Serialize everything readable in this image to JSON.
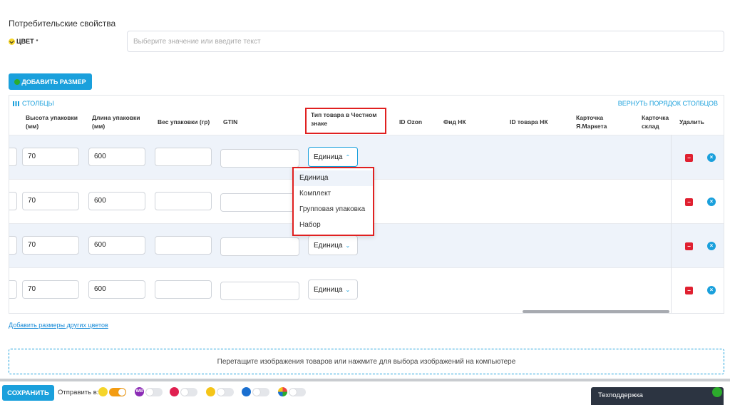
{
  "section": {
    "title": "Потребительские свойства"
  },
  "color_field": {
    "label": "ЦВЕТ",
    "required_mark": "*",
    "placeholder": "Выберите значение или введите текст"
  },
  "add_size_button": "ДОБАВИТЬ РАЗМЕР",
  "table": {
    "columns_toggle": "СТОЛБЦЫ",
    "reset_order": "ВЕРНУТЬ ПОРЯДОК СТОЛБЦОВ",
    "headers": {
      "height": "Высота упаковки (мм)",
      "length": "Длина упаковки (мм)",
      "weight": "Вес упаковки (гр)",
      "gtin": "GTIN",
      "type": "Тип товара в Честном знаке",
      "id_ozon": "ID Ozon",
      "feed_nk": "Фид НК",
      "id_nk": "ID товара НК",
      "card_ym": "Карточка Я.Маркета",
      "card_stock": "Карточка склад",
      "delete": "Удалить"
    },
    "rows": [
      {
        "height": "70",
        "length": "600",
        "weight": "",
        "gtin": "",
        "type": "Единица"
      },
      {
        "height": "70",
        "length": "600",
        "weight": "",
        "gtin": "",
        "type": "Единица"
      },
      {
        "height": "70",
        "length": "600",
        "weight": "",
        "gtin": "",
        "type": "Единица"
      },
      {
        "height": "70",
        "length": "600",
        "weight": "",
        "gtin": "",
        "type": "Единица"
      }
    ],
    "dropdown_options": [
      "Единица",
      "Комплект",
      "Групповая упаковка",
      "Набор"
    ]
  },
  "other_colors_link": "Добавить размеры других цветов",
  "dropzone_text": "Перетащите изображения товаров или нажмите для выбора изображений на компьютере",
  "footer": {
    "save": "СОХРАНИТЬ",
    "send_to": "Отправить в:",
    "marketplaces": [
      {
        "icon": "chestny-znak-icon",
        "enabled": true,
        "color": "#f5d52a"
      },
      {
        "icon": "wildberries-icon",
        "label": "WB",
        "enabled": false,
        "color": "#8b2bb5"
      },
      {
        "icon": "ozon-icon",
        "enabled": false,
        "color": "#e02050"
      },
      {
        "icon": "yandex-market-icon",
        "enabled": false,
        "color": "#f5c518"
      },
      {
        "icon": "moysklad-icon",
        "enabled": false,
        "color": "#1a6fd0"
      },
      {
        "icon": "multicolor-icon",
        "enabled": false,
        "color": "#e44"
      }
    ]
  },
  "support": "Техподдержка",
  "colors": {
    "accent": "#1aa0dc",
    "highlight": "#e02020",
    "row_alt": "#eef3fa"
  }
}
